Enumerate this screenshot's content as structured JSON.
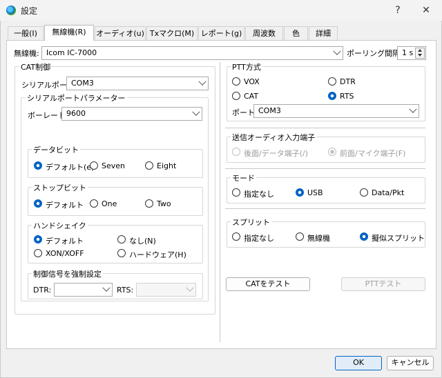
{
  "window": {
    "title": "設定",
    "help": "?",
    "close": "✕"
  },
  "tabs": [
    "一般(I)",
    "無線機(R)",
    "オーディオ(u)",
    "Txマクロ(M)",
    "レポート(g)",
    "周波数",
    "色",
    "詳細"
  ],
  "active_tab": "無線機(R)",
  "radio": {
    "label": "無線機:",
    "value": "Icom IC-7000"
  },
  "polling": {
    "label": "ポーリング間隔:",
    "value": "1 s"
  },
  "cat": {
    "group": "CAT制御",
    "serial_port_label": "シリアルポート:",
    "serial_port_value": "COM3",
    "params_group": "シリアルポートパラメーター",
    "baud_label": "ボーレート:",
    "baud_value": "9600",
    "databits": {
      "group": "データビット",
      "options": [
        "デフォルト(e)",
        "Seven",
        "Eight"
      ],
      "selected": "デフォルト(e)"
    },
    "stopbits": {
      "group": "ストップビット",
      "options": [
        "デフォルト",
        "One",
        "Two"
      ],
      "selected": "デフォルト"
    },
    "handshake": {
      "group": "ハンドシェイク",
      "options": [
        "デフォルト",
        "なし(N)",
        "XON/XOFF",
        "ハードウェア(H)"
      ],
      "selected": "デフォルト"
    },
    "force": {
      "group": "制御信号を強制設定",
      "dtr_label": "DTR:",
      "dtr_value": "",
      "rts_label": "RTS:",
      "rts_value": ""
    }
  },
  "ptt": {
    "group": "PTT方式",
    "options": [
      "VOX",
      "DTR",
      "CAT",
      "RTS"
    ],
    "selected": "RTS",
    "port_label": "ポート:",
    "port_value": "COM3"
  },
  "tx_audio": {
    "group": "送信オーディオ入力端子",
    "options": [
      "後面/データ端子(/)",
      "前面/マイク端子(F)"
    ],
    "selected": "前面/マイク端子(F)"
  },
  "mode": {
    "group": "モード",
    "options": [
      "指定なし",
      "USB",
      "Data/Pkt"
    ],
    "selected": "USB"
  },
  "split": {
    "group": "スプリット",
    "options": [
      "指定なし",
      "無線機",
      "擬似スプリット"
    ],
    "selected": "擬似スプリット"
  },
  "buttons": {
    "test_cat": "CATをテスト",
    "test_ptt": "PTTテスト",
    "ok": "OK",
    "cancel": "キャンセル"
  }
}
